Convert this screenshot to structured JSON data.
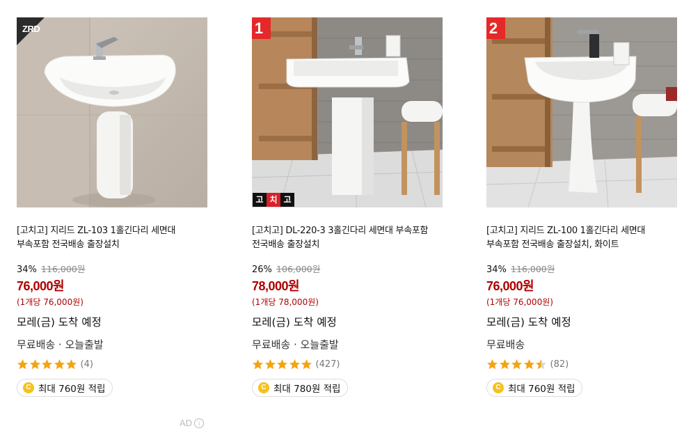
{
  "products": [
    {
      "rank": "",
      "brand_logo": "ZRD",
      "gochigo_badge": [
        "",
        "",
        ""
      ],
      "title": "[고치고] 지리드 ZL-103 1홀긴다리 세면대 부속포함 전국배송 출장설치",
      "discount": "34%",
      "original_price": "116,000원",
      "sale_price": "76,000원",
      "unit_price": "(1개당 76,000원)",
      "arrival": "모레(금) 도착 예정",
      "shipping": "무료배송 · 오늘출발",
      "rating": 5,
      "review_count": "(4)",
      "cashback": "최대 760원 적립"
    },
    {
      "rank": "1",
      "brand_logo": "",
      "gochigo_badge": [
        "고",
        "치",
        "고"
      ],
      "title": "[고치고] DL-220-3 3홀긴다리 세면대 부속포함 전국배송 출장설치",
      "discount": "26%",
      "original_price": "106,000원",
      "sale_price": "78,000원",
      "unit_price": "(1개당 78,000원)",
      "arrival": "모레(금) 도착 예정",
      "shipping": "무료배송 · 오늘출발",
      "rating": 5,
      "review_count": "(427)",
      "cashback": "최대 780원 적립"
    },
    {
      "rank": "2",
      "brand_logo": "",
      "gochigo_badge": [
        "",
        "",
        ""
      ],
      "title": "[고치고] 지리드 ZL-100 1홀긴다리 세면대 부속포함 전국배송 출장설치, 화이트",
      "discount": "34%",
      "original_price": "116,000원",
      "sale_price": "76,000원",
      "unit_price": "(1개당 76,000원)",
      "arrival": "모레(금) 도착 예정",
      "shipping": "무료배송",
      "rating": 4.5,
      "review_count": "(82)",
      "cashback": "최대 760원 적립"
    }
  ],
  "coin_symbol": "C",
  "ad_label": "AD",
  "ad_info_symbol": "i",
  "colors": {
    "sale": "#ae0000",
    "star": "#f2a412",
    "badge": "#e52828",
    "coin": "#f6c21b"
  }
}
